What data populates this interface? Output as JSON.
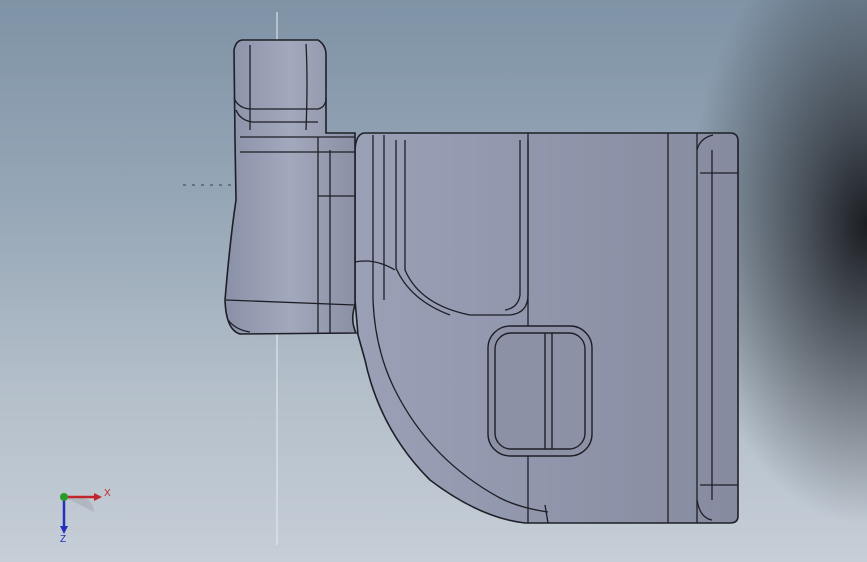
{
  "triad": {
    "x_label": "X",
    "z_label": "Z"
  },
  "colors": {
    "background_top": "#7f93a6",
    "background_bottom": "#c6ced7",
    "part_face": "#8a8fa3",
    "part_edge": "#1e1f26",
    "x_axis": "#c0262c",
    "y_axis": "#2a9a2a",
    "z_axis": "#2430c0"
  }
}
